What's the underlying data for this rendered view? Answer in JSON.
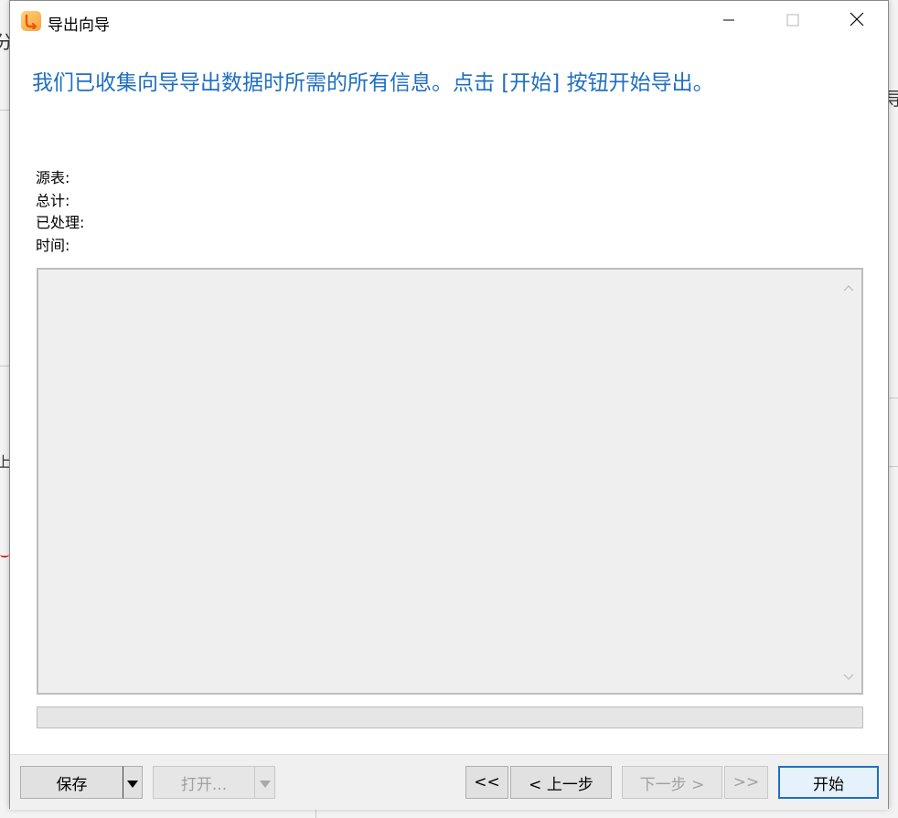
{
  "window": {
    "title": "导出向导"
  },
  "headline": "我们已收集向导导出数据时所需的所有信息。点击 [开始] 按钮开始导出。",
  "info": {
    "source_table_label": "源表:",
    "total_label": "总计:",
    "processed_label": "已处理:",
    "time_label": "时间:"
  },
  "log": {
    "content": ""
  },
  "progress": {
    "value": 0
  },
  "buttons": {
    "save": "保存",
    "open": "打开...",
    "first": "<<",
    "back": "< 上一步",
    "next": "下一步 >",
    "last": ">>",
    "start": "开始"
  },
  "background": {
    "frag_1": "分",
    "frag_2": "导",
    "frag_3": "上"
  },
  "colors": {
    "headline": "#1f6fc1",
    "primary_border": "#1f6fc1",
    "log_background": "#efefef"
  },
  "icons": {
    "app": "export-wizard-icon",
    "minimize": "minimize-icon",
    "maximize": "maximize-icon",
    "close": "close-icon",
    "scroll_up": "chevron-up-icon",
    "scroll_down": "chevron-down-icon",
    "dropdown": "dropdown-arrow-icon"
  }
}
